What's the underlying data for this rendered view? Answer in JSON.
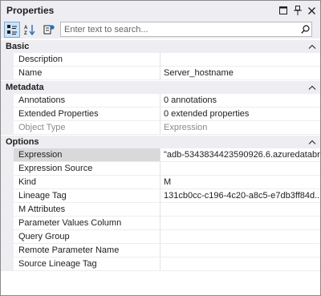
{
  "window": {
    "title": "Properties",
    "actions": [
      "window-menu-icon",
      "pin-icon",
      "close-icon"
    ]
  },
  "toolbar": {
    "buttons": [
      "categorized-icon",
      "alphabetical-icon",
      "property-pages-icon"
    ],
    "search_placeholder": "Enter text to search...",
    "search_value": ""
  },
  "categories": [
    {
      "label": "Basic",
      "rows": [
        {
          "label": "Description",
          "value": ""
        },
        {
          "label": "Name",
          "value": "Server_hostname"
        }
      ]
    },
    {
      "label": "Metadata",
      "rows": [
        {
          "label": "Annotations",
          "value": "0 annotations"
        },
        {
          "label": "Extended Properties",
          "value": "0 extended properties"
        },
        {
          "label": "Object Type",
          "value": "Expression"
        }
      ]
    },
    {
      "label": "Options",
      "rows": [
        {
          "label": "Expression",
          "value": "\"adb-5343834423590926.6.azuredatabri..."
        },
        {
          "label": "Expression Source",
          "value": ""
        },
        {
          "label": "Kind",
          "value": "M"
        },
        {
          "label": "Lineage Tag",
          "value": "131cb0cc-c196-4c20-a8c5-e7db3ff84d..."
        },
        {
          "label": "M Attributes",
          "value": ""
        },
        {
          "label": "Parameter Values Column",
          "value": ""
        },
        {
          "label": "Query Group",
          "value": ""
        },
        {
          "label": "Remote Parameter Name",
          "value": ""
        },
        {
          "label": "Source Lineage Tag",
          "value": ""
        }
      ]
    }
  ]
}
